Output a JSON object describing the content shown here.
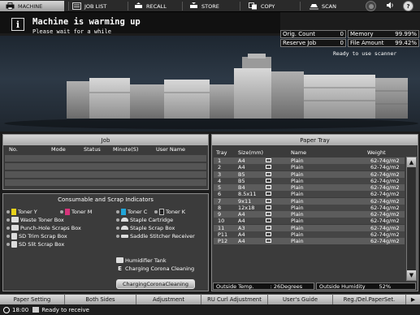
{
  "tabs": [
    {
      "label": "MACHINE",
      "icon": "printer-icon"
    },
    {
      "label": "JOB LIST",
      "icon": "job-list-icon"
    },
    {
      "label": "RECALL",
      "icon": "recall-icon"
    },
    {
      "label": "STORE",
      "icon": "store-icon"
    },
    {
      "label": "COPY",
      "icon": "copy-icon"
    },
    {
      "label": "SCAN",
      "icon": "scan-icon"
    }
  ],
  "header": {
    "title": "Machine is warming up",
    "subtitle": "Please wait for a while"
  },
  "counters": {
    "orig_count_label": "Orig. Count",
    "orig_count_value": "0",
    "reserve_job_label": "Reserve Job",
    "reserve_job_value": "0",
    "memory_label": "Memory",
    "memory_value": "99.99%",
    "file_amount_label": "File Amount",
    "file_amount_value": "99.42%"
  },
  "scanner_status": "Ready to use scanner",
  "job_panel": {
    "title": "Job",
    "columns": [
      "No.",
      "Mode",
      "Status",
      "Minute(S)",
      "User Name"
    ]
  },
  "consumables": {
    "title": "Consumable and Scrap Indicators",
    "items": [
      {
        "label": "Toner Y"
      },
      {
        "label": "Toner M"
      },
      {
        "label": "Toner C"
      },
      {
        "label": "Toner K"
      },
      {
        "label": "Waste Toner Box"
      },
      {
        "label": "Staple Cartridge"
      },
      {
        "label": "Punch-Hole Scraps Box"
      },
      {
        "label": "Staple Scrap Box"
      },
      {
        "label": "SD Trim Scrap Box"
      },
      {
        "label": "Saddle Stitcher Receiver"
      },
      {
        "label": "SD Slit Scrap Box"
      },
      {
        "label": "Humidifier Tank"
      },
      {
        "label": "Charging Corona Cleaning"
      }
    ],
    "button_label": "ChargingCoronaCleaning"
  },
  "paper_tray": {
    "title": "Paper Tray",
    "columns": [
      "Tray",
      "Size(mm)",
      "Name",
      "Weight"
    ],
    "rows": [
      {
        "tray": "1",
        "size": "A4",
        "name": "Plain",
        "weight": "62-74g/m2"
      },
      {
        "tray": "2",
        "size": "A4",
        "name": "Plain",
        "weight": "62-74g/m2"
      },
      {
        "tray": "3",
        "size": "B5",
        "name": "Plain",
        "weight": "62-74g/m2"
      },
      {
        "tray": "4",
        "size": "B5",
        "name": "Plain",
        "weight": "62-74g/m2"
      },
      {
        "tray": "5",
        "size": "B4",
        "name": "Plain",
        "weight": "62-74g/m2"
      },
      {
        "tray": "6",
        "size": "8.5x11",
        "name": "Plain",
        "weight": "62-74g/m2"
      },
      {
        "tray": "7",
        "size": "9x11",
        "name": "Plain",
        "weight": "62-74g/m2"
      },
      {
        "tray": "8",
        "size": "12x18",
        "name": "Plain",
        "weight": "62-74g/m2"
      },
      {
        "tray": "9",
        "size": "A4",
        "name": "Plain",
        "weight": "62-74g/m2"
      },
      {
        "tray": "10",
        "size": "A4",
        "name": "Plain",
        "weight": "62-74g/m2"
      },
      {
        "tray": "11",
        "size": "A3",
        "name": "Plain",
        "weight": "62-74g/m2"
      },
      {
        "tray": "P11",
        "size": "A4",
        "name": "Plain",
        "weight": "62-74g/m2"
      },
      {
        "tray": "P12",
        "size": "A4",
        "name": "Plain",
        "weight": "62-74g/m2"
      }
    ],
    "outside_temp_label": "Outside Temp.",
    "outside_temp_value": ": 26Degrees",
    "outside_humidity_label": "Outside Humidity",
    "outside_humidity_value": "52%"
  },
  "bottom_buttons": [
    "Paper Setting",
    "Both Sides",
    "Adjustment",
    "RU Curl Adjustment",
    "User's Guide",
    "Reg./Del.PaperSet."
  ],
  "status_bar": {
    "time": "18:00",
    "message": "Ready to receive"
  },
  "colors": {
    "toner_y": "#e8d21a",
    "toner_m": "#d6337a",
    "toner_c": "#20a5d8",
    "toner_k": "#222222",
    "accent_title": "#c8c8c8"
  }
}
